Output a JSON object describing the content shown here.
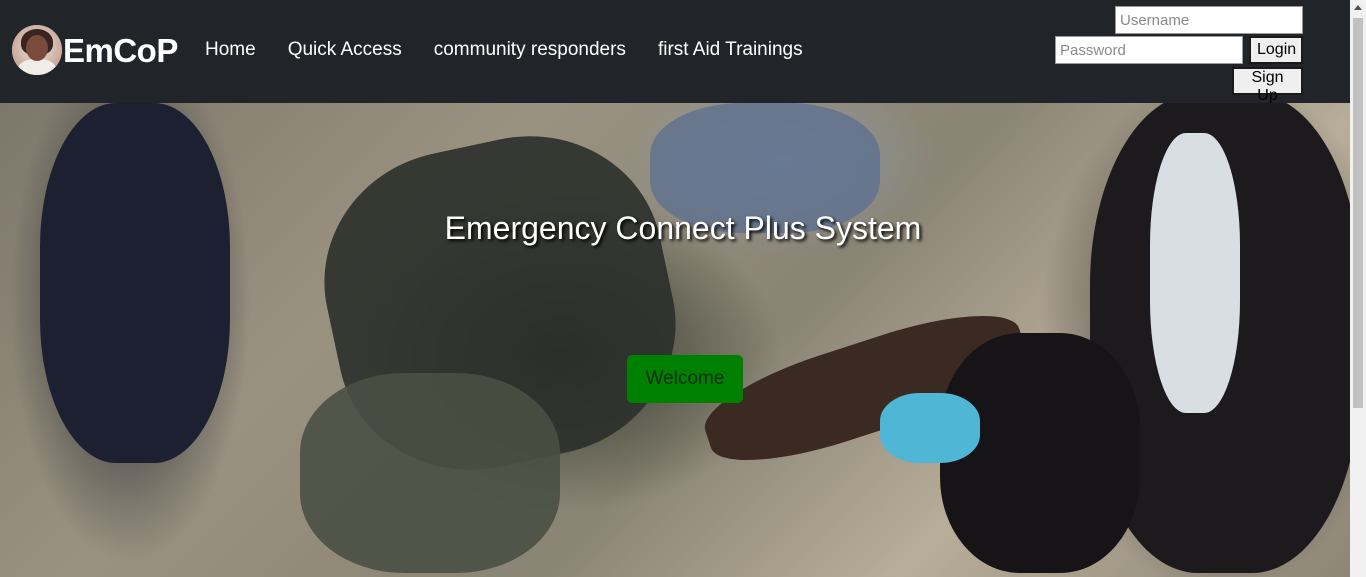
{
  "brand": {
    "name": "EmCoP"
  },
  "nav": {
    "links": [
      "Home",
      "Quick Access",
      "community responders",
      "first Aid Trainings"
    ]
  },
  "auth": {
    "username_placeholder": "Username",
    "password_placeholder": "Password",
    "login_label": "Login",
    "signup_label": "Sign Up"
  },
  "hero": {
    "title": "Emergency Connect Plus System",
    "button_label": "Welcome"
  },
  "colors": {
    "navbar": "#212529",
    "welcome_button": "#008000"
  },
  "icons": [
    "avatar-image",
    "scroll-up-arrow"
  ]
}
